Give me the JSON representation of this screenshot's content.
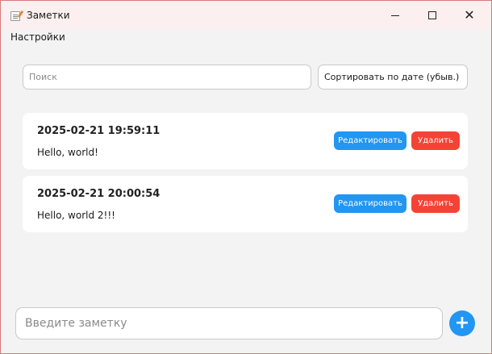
{
  "window": {
    "title": "Заметки"
  },
  "menu": {
    "settings": "Настройки"
  },
  "search": {
    "placeholder": "Поиск",
    "value": ""
  },
  "sort": {
    "selected": "Сортировать по дате (убыв.)"
  },
  "notes": [
    {
      "date": "2025-02-21 19:59:11",
      "text": "Hello, world!",
      "edit_label": "Редактировать",
      "delete_label": "Удалить"
    },
    {
      "date": "2025-02-21 20:00:54",
      "text": "Hello, world 2!!!",
      "edit_label": "Редактировать",
      "delete_label": "Удалить"
    }
  ],
  "composer": {
    "placeholder": "Введите заметку",
    "value": "",
    "add_label": "+"
  },
  "colors": {
    "edit_button": "#2196f3",
    "delete_button": "#f44336",
    "add_button": "#2196f3",
    "background": "#f3f3f3"
  }
}
